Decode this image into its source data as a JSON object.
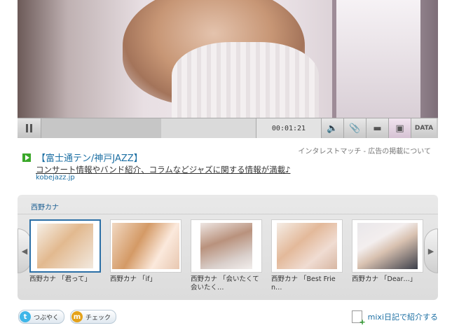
{
  "player": {
    "time": "00:01:21",
    "progress_fraction": 0.56,
    "data_label": "DATA"
  },
  "ad": {
    "info_text": "インタレストマッチ - 広告の掲載について",
    "title": "【富士通テン/神戸JAZZ】",
    "description": "コンサート情報やバンド紹介、コラムなどジャズに関する情報が満載♪",
    "url": "kobejazz.jp"
  },
  "artist": {
    "name": "西野カナ",
    "items": [
      {
        "caption": "西野カナ 「君って」",
        "selected": true
      },
      {
        "caption": "西野カナ 「if」",
        "selected": false
      },
      {
        "caption": "西野カナ 「会いたくて 会いたく…",
        "selected": false
      },
      {
        "caption": "西野カナ 「Best Frien…",
        "selected": false
      },
      {
        "caption": "西野カナ 「Dear…」",
        "selected": false
      }
    ]
  },
  "share": {
    "tweet_label": "つぶやく",
    "check_label": "チェック",
    "mixi_label": "mixi日記で紹介する"
  }
}
